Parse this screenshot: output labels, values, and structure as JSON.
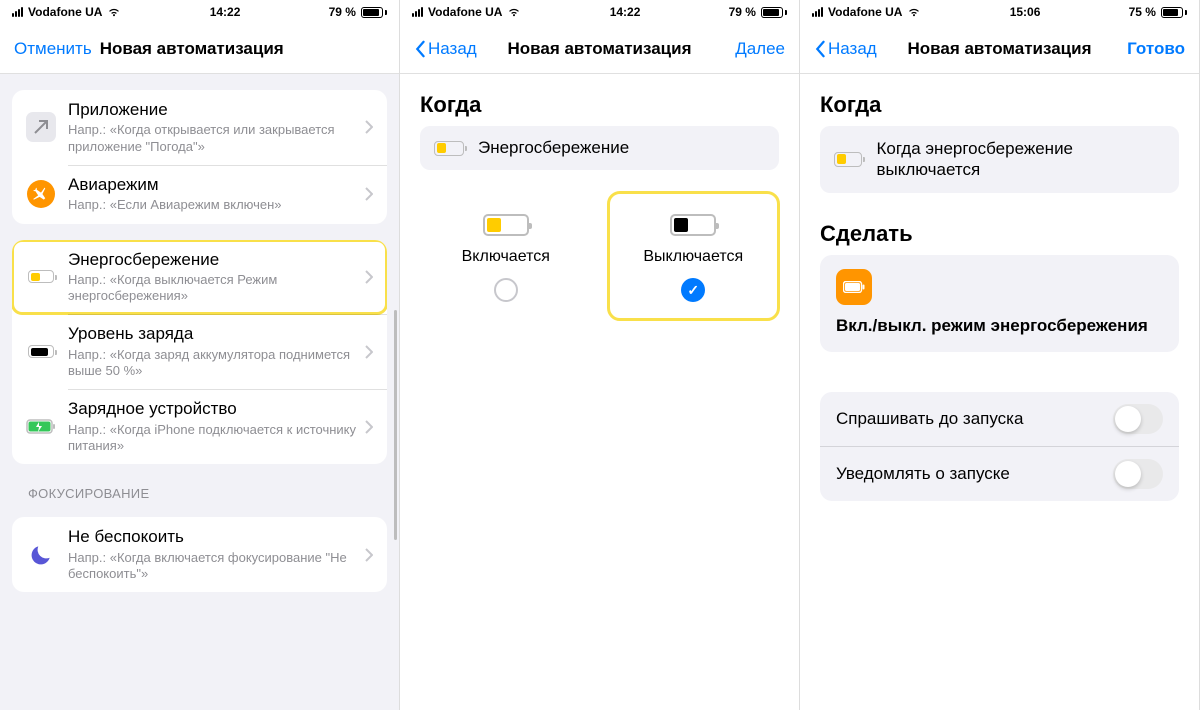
{
  "screens": [
    {
      "status": {
        "carrier": "Vodafone UA",
        "time": "14:22",
        "battery_pct": "79 %",
        "battery_fill_pct": 79
      },
      "nav": {
        "left": "Отменить",
        "title": "Новая автоматизация"
      },
      "groups": [
        [
          {
            "title": "Приложение",
            "sub": "Напр.: «Когда открывается или закрывается приложение \"Погода\"»"
          },
          {
            "title": "Авиарежим",
            "sub": "Напр.: «Если Авиарежим включен»"
          }
        ],
        [
          {
            "title": "Энергосбережение",
            "sub": "Напр.: «Когда выключается Режим энергосбережения»",
            "highlight": true
          },
          {
            "title": "Уровень заряда",
            "sub": "Напр.: «Когда заряд аккумулятора поднимется выше 50 %»"
          },
          {
            "title": "Зарядное устройство",
            "sub": "Напр.: «Когда iPhone подключается к источнику питания»"
          }
        ]
      ],
      "section_label": "ФОКУСИРОВАНИЕ",
      "group3": [
        {
          "title": "Не беспокоить",
          "sub": "Напр.: «Когда включается фокусирование \"Не беспокоить\"»"
        }
      ]
    },
    {
      "status": {
        "carrier": "Vodafone UA",
        "time": "14:22",
        "battery_pct": "79 %",
        "battery_fill_pct": 79
      },
      "nav": {
        "left": "Назад",
        "title": "Новая автоматизация",
        "right": "Далее"
      },
      "when_label": "Когда",
      "trigger": "Энергосбережение",
      "choices": {
        "on": "Включается",
        "off": "Выключается"
      }
    },
    {
      "status": {
        "carrier": "Vodafone UA",
        "time": "15:06",
        "battery_pct": "75 %",
        "battery_fill_pct": 75
      },
      "nav": {
        "left": "Назад",
        "title": "Новая автоматизация",
        "right": "Готово"
      },
      "when_label": "Когда",
      "trigger": "Когда энергосбережение выключается",
      "do_label": "Сделать",
      "action_title": "Вкл./выкл. режим энергосбережения",
      "toggles": {
        "ask": "Спрашивать до запуска",
        "notify": "Уведомлять о запуске"
      }
    }
  ]
}
